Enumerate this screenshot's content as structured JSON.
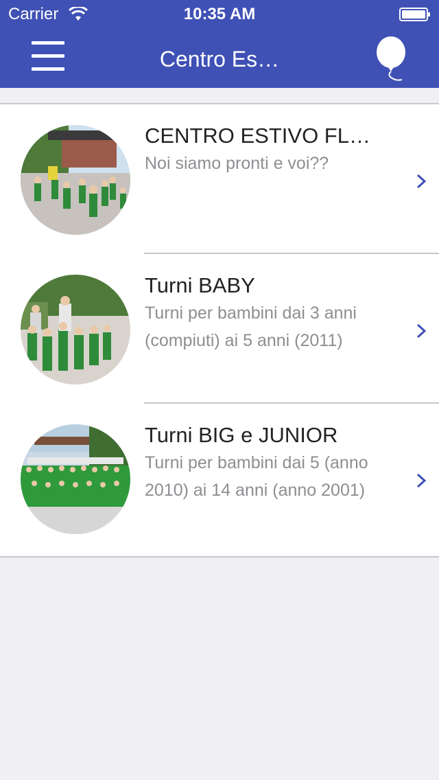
{
  "status_bar": {
    "carrier": "Carrier",
    "time": "10:35 AM"
  },
  "nav": {
    "title": "Centro Es…",
    "menu_icon": "hamburger-menu-icon",
    "balloon_icon": "balloon-icon"
  },
  "items": [
    {
      "title": "CENTRO ESTIVO FLO…",
      "subtitle": "Noi siamo pronti e voi??"
    },
    {
      "title": "Turni BABY",
      "subtitle": "Turni per bambini dai 3 anni (compiuti) ai 5 anni (2011)"
    },
    {
      "title": "Turni BIG e JUNIOR",
      "subtitle": "Turni per bambini dai 5 (anno 2010) ai 14 anni (anno 2001)"
    }
  ],
  "colors": {
    "header": "#3f51b5",
    "chevron": "#3f51b5",
    "background": "#efeff4"
  }
}
